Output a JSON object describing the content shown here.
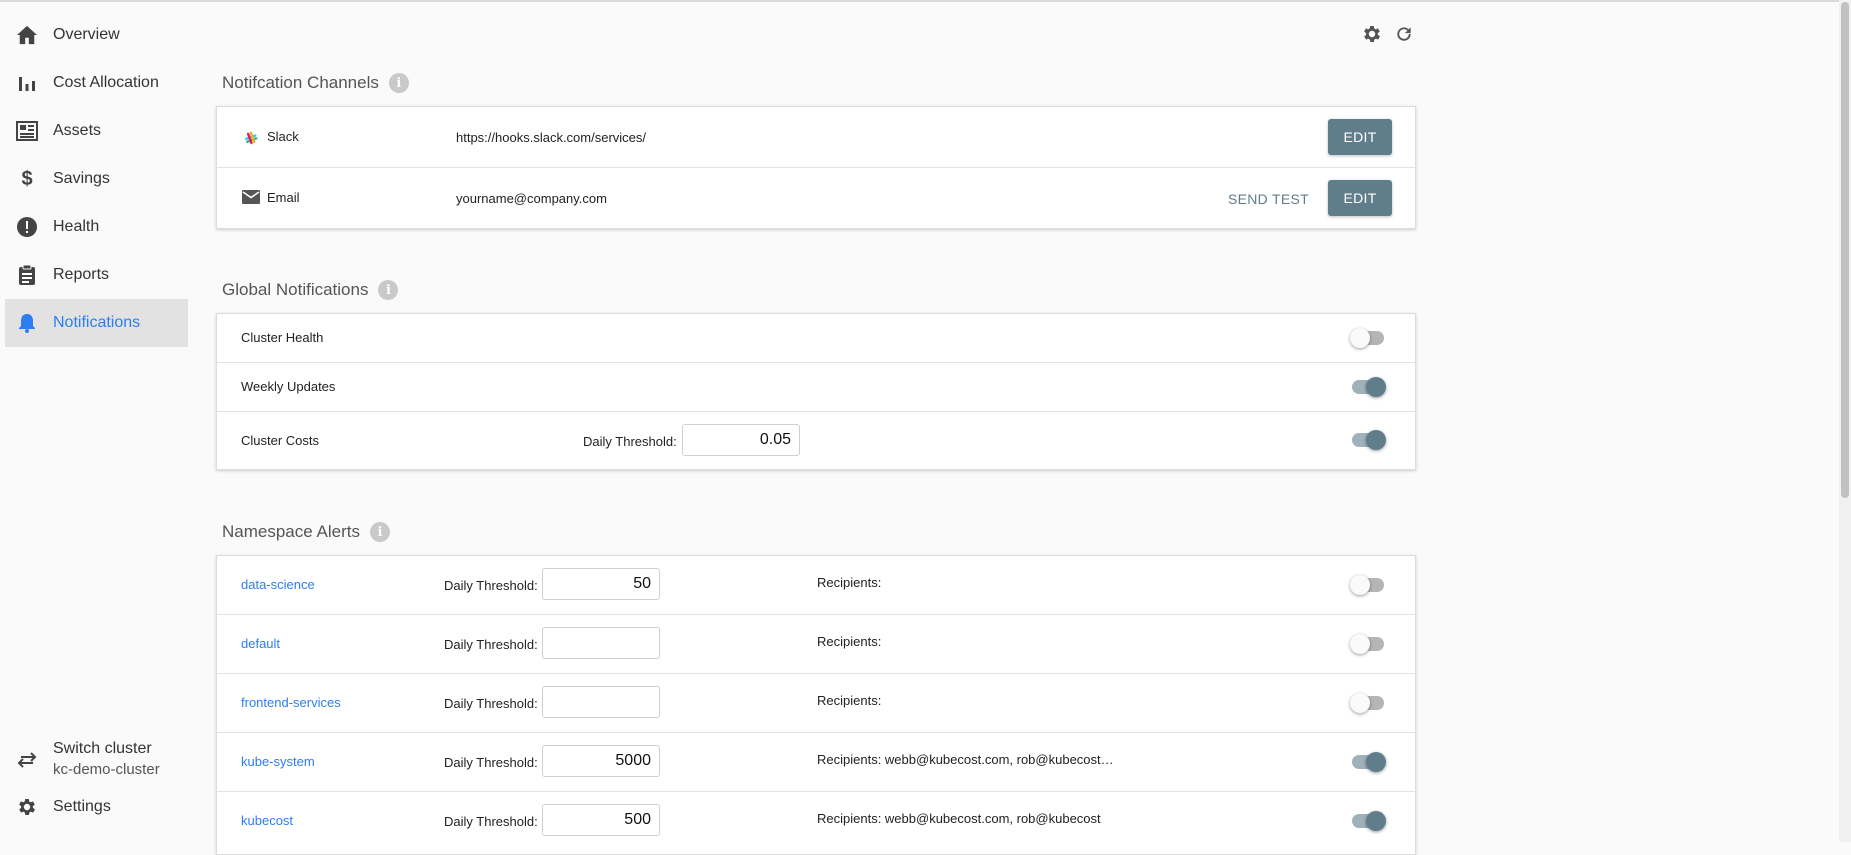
{
  "sidebar": {
    "items": [
      {
        "label": "Overview",
        "icon": "home-icon"
      },
      {
        "label": "Cost Allocation",
        "icon": "bar-chart-icon"
      },
      {
        "label": "Assets",
        "icon": "assets-icon"
      },
      {
        "label": "Savings",
        "icon": "dollar-icon"
      },
      {
        "label": "Health",
        "icon": "alert-circle-icon"
      },
      {
        "label": "Reports",
        "icon": "clipboard-icon"
      },
      {
        "label": "Notifications",
        "icon": "bell-icon",
        "active": true
      }
    ],
    "switch_cluster": {
      "label": "Switch cluster",
      "cluster": "kc-demo-cluster",
      "icon": "swap-icon"
    },
    "settings": {
      "label": "Settings",
      "icon": "gear-icon"
    }
  },
  "colors": {
    "accent": "#2e7df0",
    "button": "#607d8b",
    "active_bg": "#e2e2e2"
  },
  "channels": {
    "title": "Notifcation Channels",
    "rows": [
      {
        "name": "Slack",
        "icon": "slack-icon",
        "value": "https://hooks.slack.com/services/",
        "edit": "EDIT"
      },
      {
        "name": "Email",
        "icon": "mail-icon",
        "value": "yourname@company.com",
        "send_test": "SEND TEST",
        "edit": "EDIT"
      }
    ]
  },
  "global": {
    "title": "Global Notifications",
    "rows": [
      {
        "label": "Cluster Health",
        "enabled": false
      },
      {
        "label": "Weekly Updates",
        "enabled": true
      },
      {
        "label": "Cluster Costs",
        "threshold_label": "Daily Threshold:",
        "threshold": "0.05",
        "enabled": true
      }
    ]
  },
  "namespace": {
    "title": "Namespace Alerts",
    "threshold_label": "Daily Threshold:",
    "rows": [
      {
        "name": "data-science",
        "threshold": "50",
        "recipients": "Recipients:",
        "enabled": false
      },
      {
        "name": "default",
        "threshold": "",
        "recipients": "Recipients:",
        "enabled": false
      },
      {
        "name": "frontend-services",
        "threshold": "",
        "recipients": "Recipients:",
        "enabled": false
      },
      {
        "name": "kube-system",
        "threshold": "5000",
        "recipients": "Recipients: webb@kubecost.com, rob@kubecost…",
        "enabled": true
      },
      {
        "name": "kubecost",
        "threshold": "500",
        "recipients": "Recipients: webb@kubecost.com, rob@kubecost",
        "enabled": true
      }
    ]
  }
}
